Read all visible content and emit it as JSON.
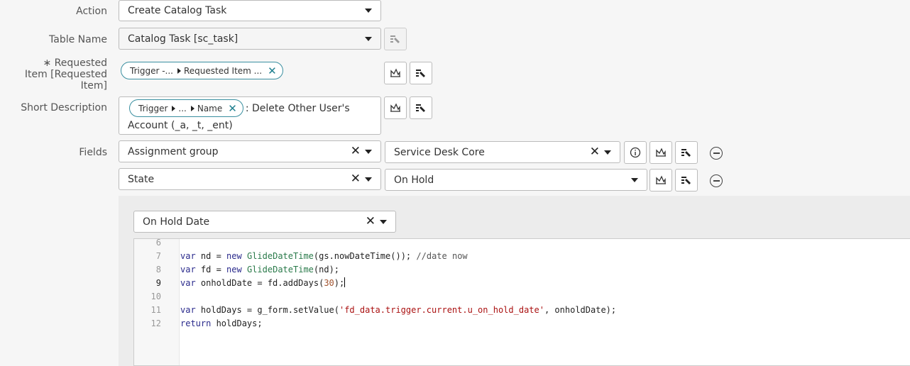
{
  "action": {
    "label": "Action",
    "value": "Create Catalog Task"
  },
  "table_name": {
    "label": "Table Name",
    "value": "Catalog Task [sc_task]"
  },
  "requested_item": {
    "label_line1": "∗ Requested",
    "label_line2": "Item [Requested",
    "label_line3": "Item]",
    "pill": {
      "part1": "Trigger -...",
      "part2": "Requested Item ..."
    }
  },
  "short_description": {
    "label": "Short Description",
    "pill": {
      "part1": "Trigger",
      "part2": "...",
      "part3": "Name"
    },
    "text_line1": ": Delete Other User's",
    "text_line2": "Account (_a, _t, _ent)"
  },
  "fields": {
    "label": "Fields",
    "rows": [
      {
        "field": "Assignment group",
        "value": "Service Desk Core"
      },
      {
        "field": "State",
        "value": "On Hold"
      }
    ]
  },
  "subfield": {
    "value": "On Hold Date"
  },
  "editor": {
    "line_numbers": [
      "6",
      "7",
      "8",
      "9",
      "10",
      "11",
      "12"
    ],
    "active_line": "9",
    "lines": [
      "",
      "var nd = new GlideDateTime(gs.nowDateTime()); //date now",
      "var fd = new GlideDateTime(nd);",
      "var onholdDate = fd.addDays(30);",
      "",
      "var holdDays = g_form.setValue('fd_data.trigger.current.u_on_hold_date', onholdDate);",
      "return holdDays;"
    ]
  },
  "icons": {
    "pill_remove": "✕",
    "clear": "✕"
  },
  "colors": {
    "pill_border": "#3a8fa0",
    "pill_x": "#1f7f8f"
  }
}
